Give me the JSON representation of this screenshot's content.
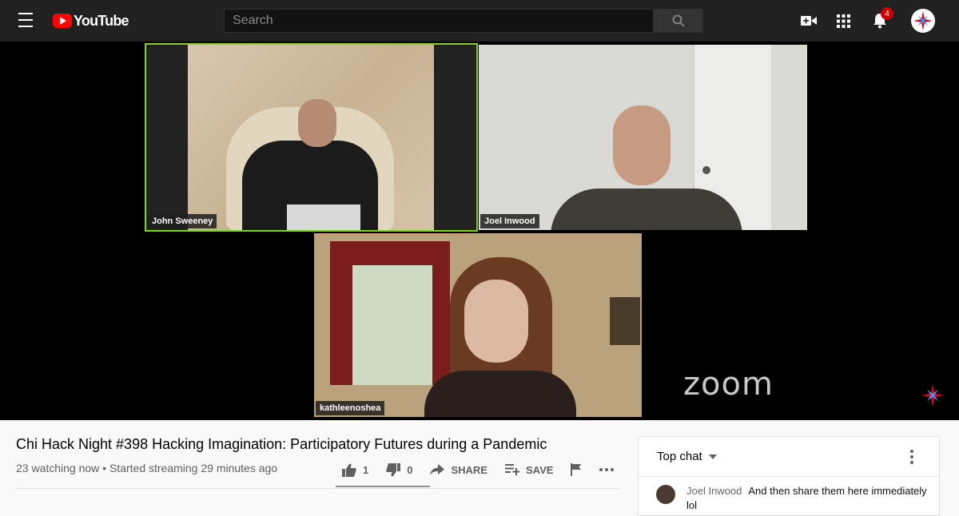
{
  "header": {
    "logo_text": "YouTube",
    "search_placeholder": "Search",
    "notification_count": "4"
  },
  "video": {
    "participants": [
      "John Sweeney",
      "Joel Inwood",
      "kathleenoshea"
    ],
    "watermark": "zoom",
    "active_speaker_color": "#7ed321"
  },
  "info": {
    "title": "Chi Hack Night #398 Hacking Imagination: Participatory Futures during a Pandemic",
    "meta": "23 watching now • Started streaming 29 minutes ago",
    "likes": "1",
    "dislikes": "0",
    "share_label": "SHARE",
    "save_label": "SAVE"
  },
  "chat": {
    "header": "Top chat",
    "message": {
      "author": "Joel Inwood",
      "text": "And then share them here immediately",
      "continuation": "lol"
    }
  },
  "colors": {
    "topbar": "#212121",
    "brand_red": "#ff0000",
    "badge": "#cc0000"
  }
}
